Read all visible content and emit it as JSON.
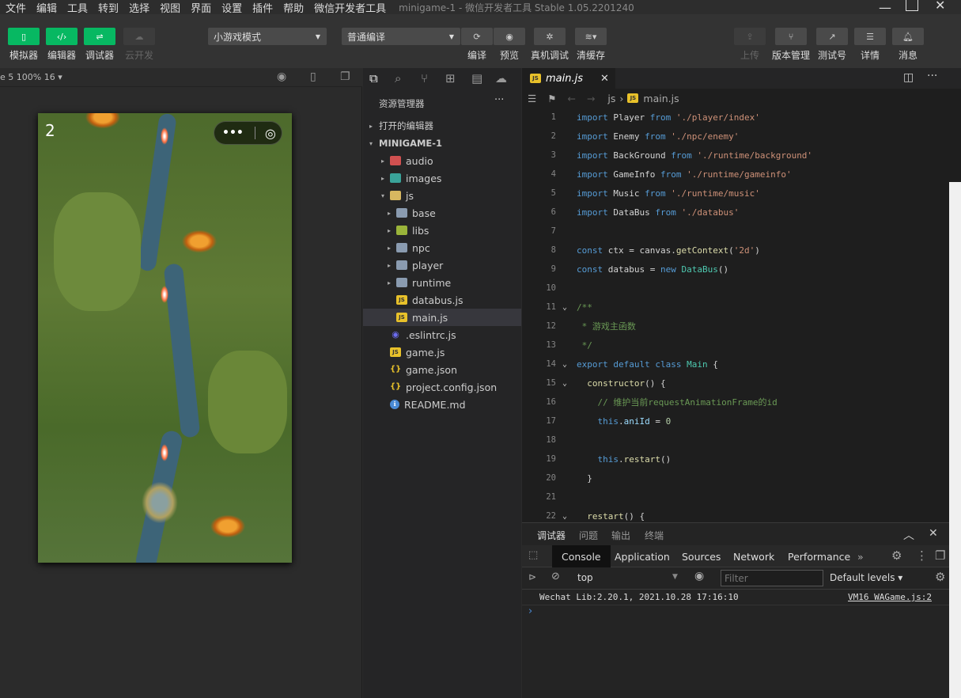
{
  "menubar": {
    "items": [
      "文件",
      "编辑",
      "工具",
      "转到",
      "选择",
      "视图",
      "界面",
      "设置",
      "插件",
      "帮助",
      "微信开发者工具"
    ],
    "title": "minigame-1 - 微信开发者工具 Stable 1.05.2201240"
  },
  "toolbar": {
    "simulator": "模拟器",
    "editor": "编辑器",
    "debugger": "调试器",
    "cloud": "云开发",
    "mode_select": "小游戏模式",
    "compile_select": "普通编译",
    "compile": "编译",
    "preview": "预览",
    "remote_debug": "真机调试",
    "clear_cache": "清缓存",
    "upload": "上传",
    "version": "版本管理",
    "test_id": "测试号",
    "details": "详情",
    "messages": "消息"
  },
  "simulator": {
    "device_label": "e 5 100% 16 ▾",
    "score": "2"
  },
  "explorer": {
    "title": "资源管理器",
    "open_editors": "打开的编辑器",
    "project": "MINIGAME-1",
    "items": [
      {
        "name": "audio",
        "type": "folder",
        "depth": 1,
        "arrow": "▸"
      },
      {
        "name": "images",
        "type": "folder",
        "depth": 1,
        "arrow": "▸"
      },
      {
        "name": "js",
        "type": "folder-open",
        "depth": 1,
        "arrow": "▾"
      },
      {
        "name": "base",
        "type": "folder",
        "depth": 2,
        "arrow": "▸"
      },
      {
        "name": "libs",
        "type": "folder",
        "depth": 2,
        "arrow": "▸"
      },
      {
        "name": "npc",
        "type": "folder",
        "depth": 2,
        "arrow": "▸"
      },
      {
        "name": "player",
        "type": "folder",
        "depth": 2,
        "arrow": "▸"
      },
      {
        "name": "runtime",
        "type": "folder",
        "depth": 2,
        "arrow": "▸"
      },
      {
        "name": "databus.js",
        "type": "js",
        "depth": 2,
        "arrow": ""
      },
      {
        "name": "main.js",
        "type": "js",
        "depth": 2,
        "arrow": "",
        "selected": true
      },
      {
        "name": ".eslintrc.js",
        "type": "eslint",
        "depth": 1,
        "arrow": ""
      },
      {
        "name": "game.js",
        "type": "js",
        "depth": 1,
        "arrow": ""
      },
      {
        "name": "game.json",
        "type": "json",
        "depth": 1,
        "arrow": ""
      },
      {
        "name": "project.config.json",
        "type": "json",
        "depth": 1,
        "arrow": ""
      },
      {
        "name": "README.md",
        "type": "info",
        "depth": 1,
        "arrow": ""
      }
    ]
  },
  "editor": {
    "tab": "main.js",
    "breadcrumb": [
      "js",
      "main.js"
    ],
    "lines": [
      {
        "n": "1",
        "fold": "",
        "t": [
          [
            "kw",
            "import"
          ],
          [
            "pl",
            " Player "
          ],
          [
            "kw",
            "from"
          ],
          [
            "pl",
            " "
          ],
          [
            "str",
            "'./player/index'"
          ]
        ]
      },
      {
        "n": "2",
        "fold": "",
        "t": [
          [
            "kw",
            "import"
          ],
          [
            "pl",
            " Enemy "
          ],
          [
            "kw",
            "from"
          ],
          [
            "pl",
            " "
          ],
          [
            "str",
            "'./npc/enemy'"
          ]
        ]
      },
      {
        "n": "3",
        "fold": "",
        "t": [
          [
            "kw",
            "import"
          ],
          [
            "pl",
            " BackGround "
          ],
          [
            "kw",
            "from"
          ],
          [
            "pl",
            " "
          ],
          [
            "str",
            "'./runtime/background'"
          ]
        ]
      },
      {
        "n": "4",
        "fold": "",
        "t": [
          [
            "kw",
            "import"
          ],
          [
            "pl",
            " GameInfo "
          ],
          [
            "kw",
            "from"
          ],
          [
            "pl",
            " "
          ],
          [
            "str",
            "'./runtime/gameinfo'"
          ]
        ]
      },
      {
        "n": "5",
        "fold": "",
        "t": [
          [
            "kw",
            "import"
          ],
          [
            "pl",
            " Music "
          ],
          [
            "kw",
            "from"
          ],
          [
            "pl",
            " "
          ],
          [
            "str",
            "'./runtime/music'"
          ]
        ]
      },
      {
        "n": "6",
        "fold": "",
        "t": [
          [
            "kw",
            "import"
          ],
          [
            "pl",
            " DataBus "
          ],
          [
            "kw",
            "from"
          ],
          [
            "pl",
            " "
          ],
          [
            "str",
            "'./databus'"
          ]
        ]
      },
      {
        "n": "7",
        "fold": "",
        "t": []
      },
      {
        "n": "8",
        "fold": "",
        "t": [
          [
            "kw",
            "const"
          ],
          [
            "pl",
            " ctx = canvas."
          ],
          [
            "fn",
            "getContext"
          ],
          [
            "pl",
            "("
          ],
          [
            "str",
            "'2d'"
          ],
          [
            "pl",
            ")"
          ]
        ]
      },
      {
        "n": "9",
        "fold": "",
        "t": [
          [
            "kw",
            "const"
          ],
          [
            "pl",
            " databus = "
          ],
          [
            "kw",
            "new"
          ],
          [
            "pl",
            " "
          ],
          [
            "cls",
            "DataBus"
          ],
          [
            "pl",
            "()"
          ]
        ]
      },
      {
        "n": "10",
        "fold": "",
        "t": []
      },
      {
        "n": "11",
        "fold": "⌄",
        "t": [
          [
            "cm",
            "/**"
          ]
        ]
      },
      {
        "n": "12",
        "fold": "",
        "t": [
          [
            "cm",
            " * 游戏主函数"
          ]
        ]
      },
      {
        "n": "13",
        "fold": "",
        "t": [
          [
            "cm",
            " */"
          ]
        ]
      },
      {
        "n": "14",
        "fold": "⌄",
        "t": [
          [
            "kw",
            "export"
          ],
          [
            "pl",
            " "
          ],
          [
            "kw",
            "default"
          ],
          [
            "pl",
            " "
          ],
          [
            "kw",
            "class"
          ],
          [
            "pl",
            " "
          ],
          [
            "cls",
            "Main"
          ],
          [
            "pl",
            " {"
          ]
        ]
      },
      {
        "n": "15",
        "fold": "⌄",
        "t": [
          [
            "pl",
            "  "
          ],
          [
            "fn",
            "constructor"
          ],
          [
            "pl",
            "() {"
          ]
        ]
      },
      {
        "n": "16",
        "fold": "",
        "t": [
          [
            "pl",
            "    "
          ],
          [
            "cm",
            "// 维护当前requestAnimationFrame的id"
          ]
        ]
      },
      {
        "n": "17",
        "fold": "",
        "t": [
          [
            "pl",
            "    "
          ],
          [
            "kw",
            "this"
          ],
          [
            "pl",
            "."
          ],
          [
            "pr",
            "aniId"
          ],
          [
            "pl",
            " = "
          ],
          [
            "num",
            "0"
          ]
        ]
      },
      {
        "n": "18",
        "fold": "",
        "t": []
      },
      {
        "n": "19",
        "fold": "",
        "t": [
          [
            "pl",
            "    "
          ],
          [
            "kw",
            "this"
          ],
          [
            "pl",
            "."
          ],
          [
            "fn",
            "restart"
          ],
          [
            "pl",
            "()"
          ]
        ]
      },
      {
        "n": "20",
        "fold": "",
        "t": [
          [
            "pl",
            "  }"
          ]
        ]
      },
      {
        "n": "21",
        "fold": "",
        "t": []
      },
      {
        "n": "22",
        "fold": "⌄",
        "t": [
          [
            "pl",
            "  "
          ],
          [
            "fn",
            "restart"
          ],
          [
            "pl",
            "() {"
          ]
        ]
      }
    ]
  },
  "debugger": {
    "panel_tabs": [
      "调试器",
      "问题",
      "输出",
      "终端"
    ],
    "dev_tabs": [
      "Console",
      "Application",
      "Sources",
      "Network",
      "Performance"
    ],
    "more": "»",
    "context": "top",
    "filter_placeholder": "Filter",
    "levels": "Default levels ▾",
    "message": "Wechat Lib:2.20.1, 2021.10.28 17:16:10",
    "source": "VM16 WAGame.js:2",
    "prompt": "›"
  },
  "colors": {
    "accent": "#07b862",
    "keyword": "#569cd6",
    "string": "#ce9178"
  }
}
